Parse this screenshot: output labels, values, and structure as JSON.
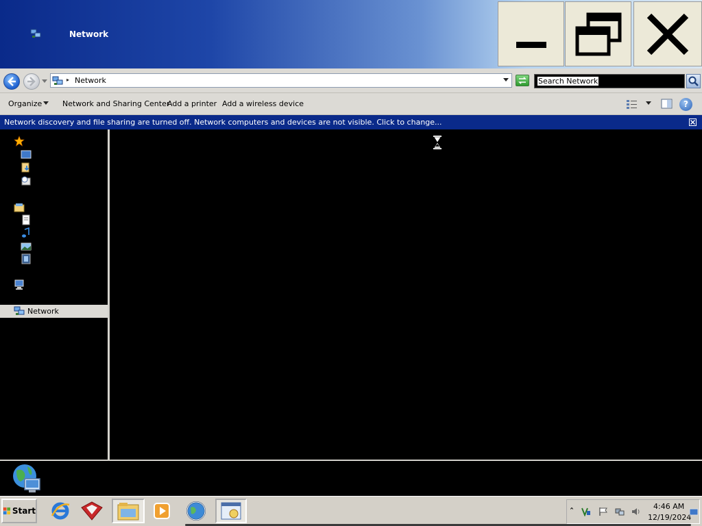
{
  "window": {
    "title": "Network",
    "buttons": {
      "minimize": "minimize",
      "maximize": "restore",
      "close": "close"
    }
  },
  "address": {
    "path": "Network",
    "search_value": "Search Network"
  },
  "commandbar": {
    "items": [
      "Organize",
      "Network and Sharing Center",
      "Add a printer",
      "Add a wireless device"
    ]
  },
  "infobar": {
    "message": "Network discovery and file sharing are turned off. Network computers and devices are not visible. Click to change..."
  },
  "navpane": {
    "selected_label": "Network",
    "icons": [
      "favorites-star-icon",
      "desktop-icon",
      "downloads-icon",
      "recent-places-icon",
      "libraries-icon",
      "documents-icon",
      "music-icon",
      "pictures-icon",
      "videos-icon",
      "computer-icon",
      "network-icon"
    ]
  },
  "taskbar": {
    "start_label": "Start",
    "apps": [
      "internet-explorer-icon",
      "app-icon",
      "windows-explorer-icon",
      "media-player-icon",
      "browser-icon",
      "program-icon"
    ],
    "clock_time": "4:46 AM",
    "clock_date": "12/19/2024"
  },
  "colors": {
    "title_start": "#0a2a8a",
    "title_end": "#d8e6f2",
    "infobar": "#0a2a8a",
    "chrome": "#dcdad5"
  }
}
